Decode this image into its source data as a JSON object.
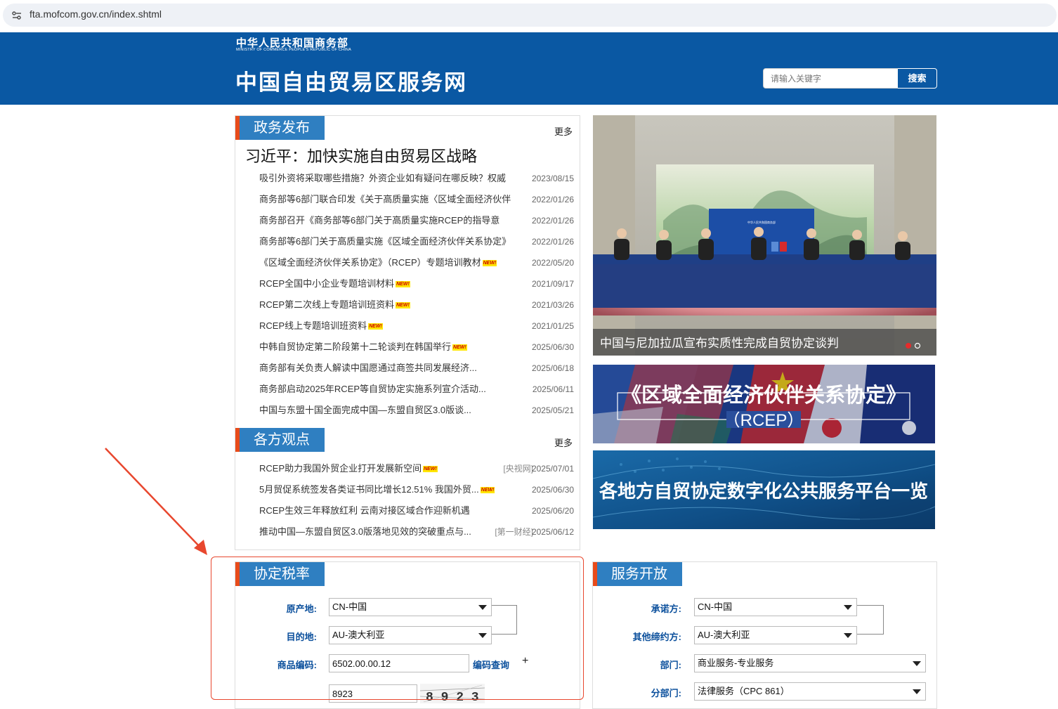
{
  "browser": {
    "url": "fta.mofcom.gov.cn/index.shtml",
    "site_info_icon": "tune-icon"
  },
  "header": {
    "ministry_cn": "中华人民共和国商务部",
    "ministry_en": "MINISTRY OF COMMERCE PEOPLE'S REPUBLIC OF CHINA",
    "site_title": "中国自由贸易区服务网",
    "search_placeholder": "请输入关键字",
    "search_button": "搜索"
  },
  "gov_news": {
    "title": "政务发布",
    "more": "更多",
    "headline": "习近平：加快实施自由贸易区战略",
    "items": [
      {
        "text": "吸引外资将采取哪些措施？外资企业如有疑问在哪反映？权威",
        "date": "2023/08/15",
        "is_new": false
      },
      {
        "text": "商务部等6部门联合印发《关于高质量实施〈区域全面经济伙伴",
        "date": "2022/01/26",
        "is_new": false
      },
      {
        "text": "商务部召开《商务部等6部门关于高质量实施RCEP的指导意",
        "date": "2022/01/26",
        "is_new": false
      },
      {
        "text": "商务部等6部门关于高质量实施《区域全面经济伙伴关系协定》",
        "date": "2022/01/26",
        "is_new": false
      },
      {
        "text": "《区域全面经济伙伴关系协定》（RCEP）专题培训教材",
        "date": "2022/05/20",
        "is_new": true
      },
      {
        "text": "RCEP全国中小企业专题培训材料",
        "date": "2021/09/17",
        "is_new": true
      },
      {
        "text": "RCEP第二次线上专题培训班资料",
        "date": "2021/03/26",
        "is_new": true
      },
      {
        "text": "RCEP线上专题培训班资料",
        "date": "2021/01/25",
        "is_new": true
      },
      {
        "text": "中韩自贸协定第二阶段第十二轮谈判在韩国举行",
        "date": "2025/06/30",
        "is_new": true
      },
      {
        "text": "商务部有关负责人解读中国愿通过商签共同发展经济...",
        "date": "2025/06/18",
        "is_new": false
      },
      {
        "text": "商务部启动2025年RCEP等自贸协定实施系列宣介活动...",
        "date": "2025/06/11",
        "is_new": false
      },
      {
        "text": "中国与东盟十国全面完成中国—东盟自贸区3.0版谈...",
        "date": "2025/05/21",
        "is_new": false
      }
    ]
  },
  "views": {
    "title": "各方观点",
    "more": "更多",
    "items": [
      {
        "text": "RCEP助力我国外贸企业打开发展新空间",
        "source": "[央视网]",
        "date": "2025/07/01",
        "is_new": true
      },
      {
        "text": "5月贸促系统签发各类证书同比增长12.51% 我国外贸...",
        "source": "",
        "date": "2025/06/30",
        "is_new": true
      },
      {
        "text": "RCEP生效三年释放红利 云南对接区域合作迎新机遇",
        "source": "",
        "date": "2025/06/20",
        "is_new": false
      },
      {
        "text": "推动中国—东盟自贸区3.0版落地见效的突破重点与...",
        "source": "[第一财经]",
        "date": "2025/06/12",
        "is_new": false
      }
    ],
    "new_badge": "NEW!"
  },
  "carousel": {
    "caption": "中国与尼加拉瓜宣布实质性完成自贸协定谈判",
    "dots": 2,
    "active_dot": 1,
    "backdrop_text": "中华人民共和国商务部"
  },
  "banner_rcep": {
    "title": "《区域全面经济伙伴关系协定》",
    "subtitle": "（RCEP）"
  },
  "banner_platform": {
    "title": "各地方自贸协定数字化公共服务平台一览"
  },
  "tariff": {
    "title": "协定税率",
    "origin_label": "原产地:",
    "origin_value": "CN-中国",
    "dest_label": "目的地:",
    "dest_value": "AU-澳大利亚",
    "code_label": "商品编码:",
    "code_value": "6502.00.00.12",
    "code_lookup": "编码查询",
    "plus": "+",
    "captcha_value": "8923",
    "captcha_image_text": "8 9 2 3"
  },
  "services": {
    "title": "服务开放",
    "committer_label": "承诺方:",
    "committer_value": "CN-中国",
    "other_label": "其他缔约方:",
    "other_value": "AU-澳大利亚",
    "dept_label": "部门:",
    "dept_value": "商业服务-专业服务",
    "subdept_label": "分部门:",
    "subdept_value": "法律服务（CPC 861）"
  },
  "colors": {
    "header_blue": "#0a58a3",
    "section_blue": "#2f7fc1",
    "accent_orange": "#e84b1a",
    "annotation_red": "#e8472e"
  }
}
